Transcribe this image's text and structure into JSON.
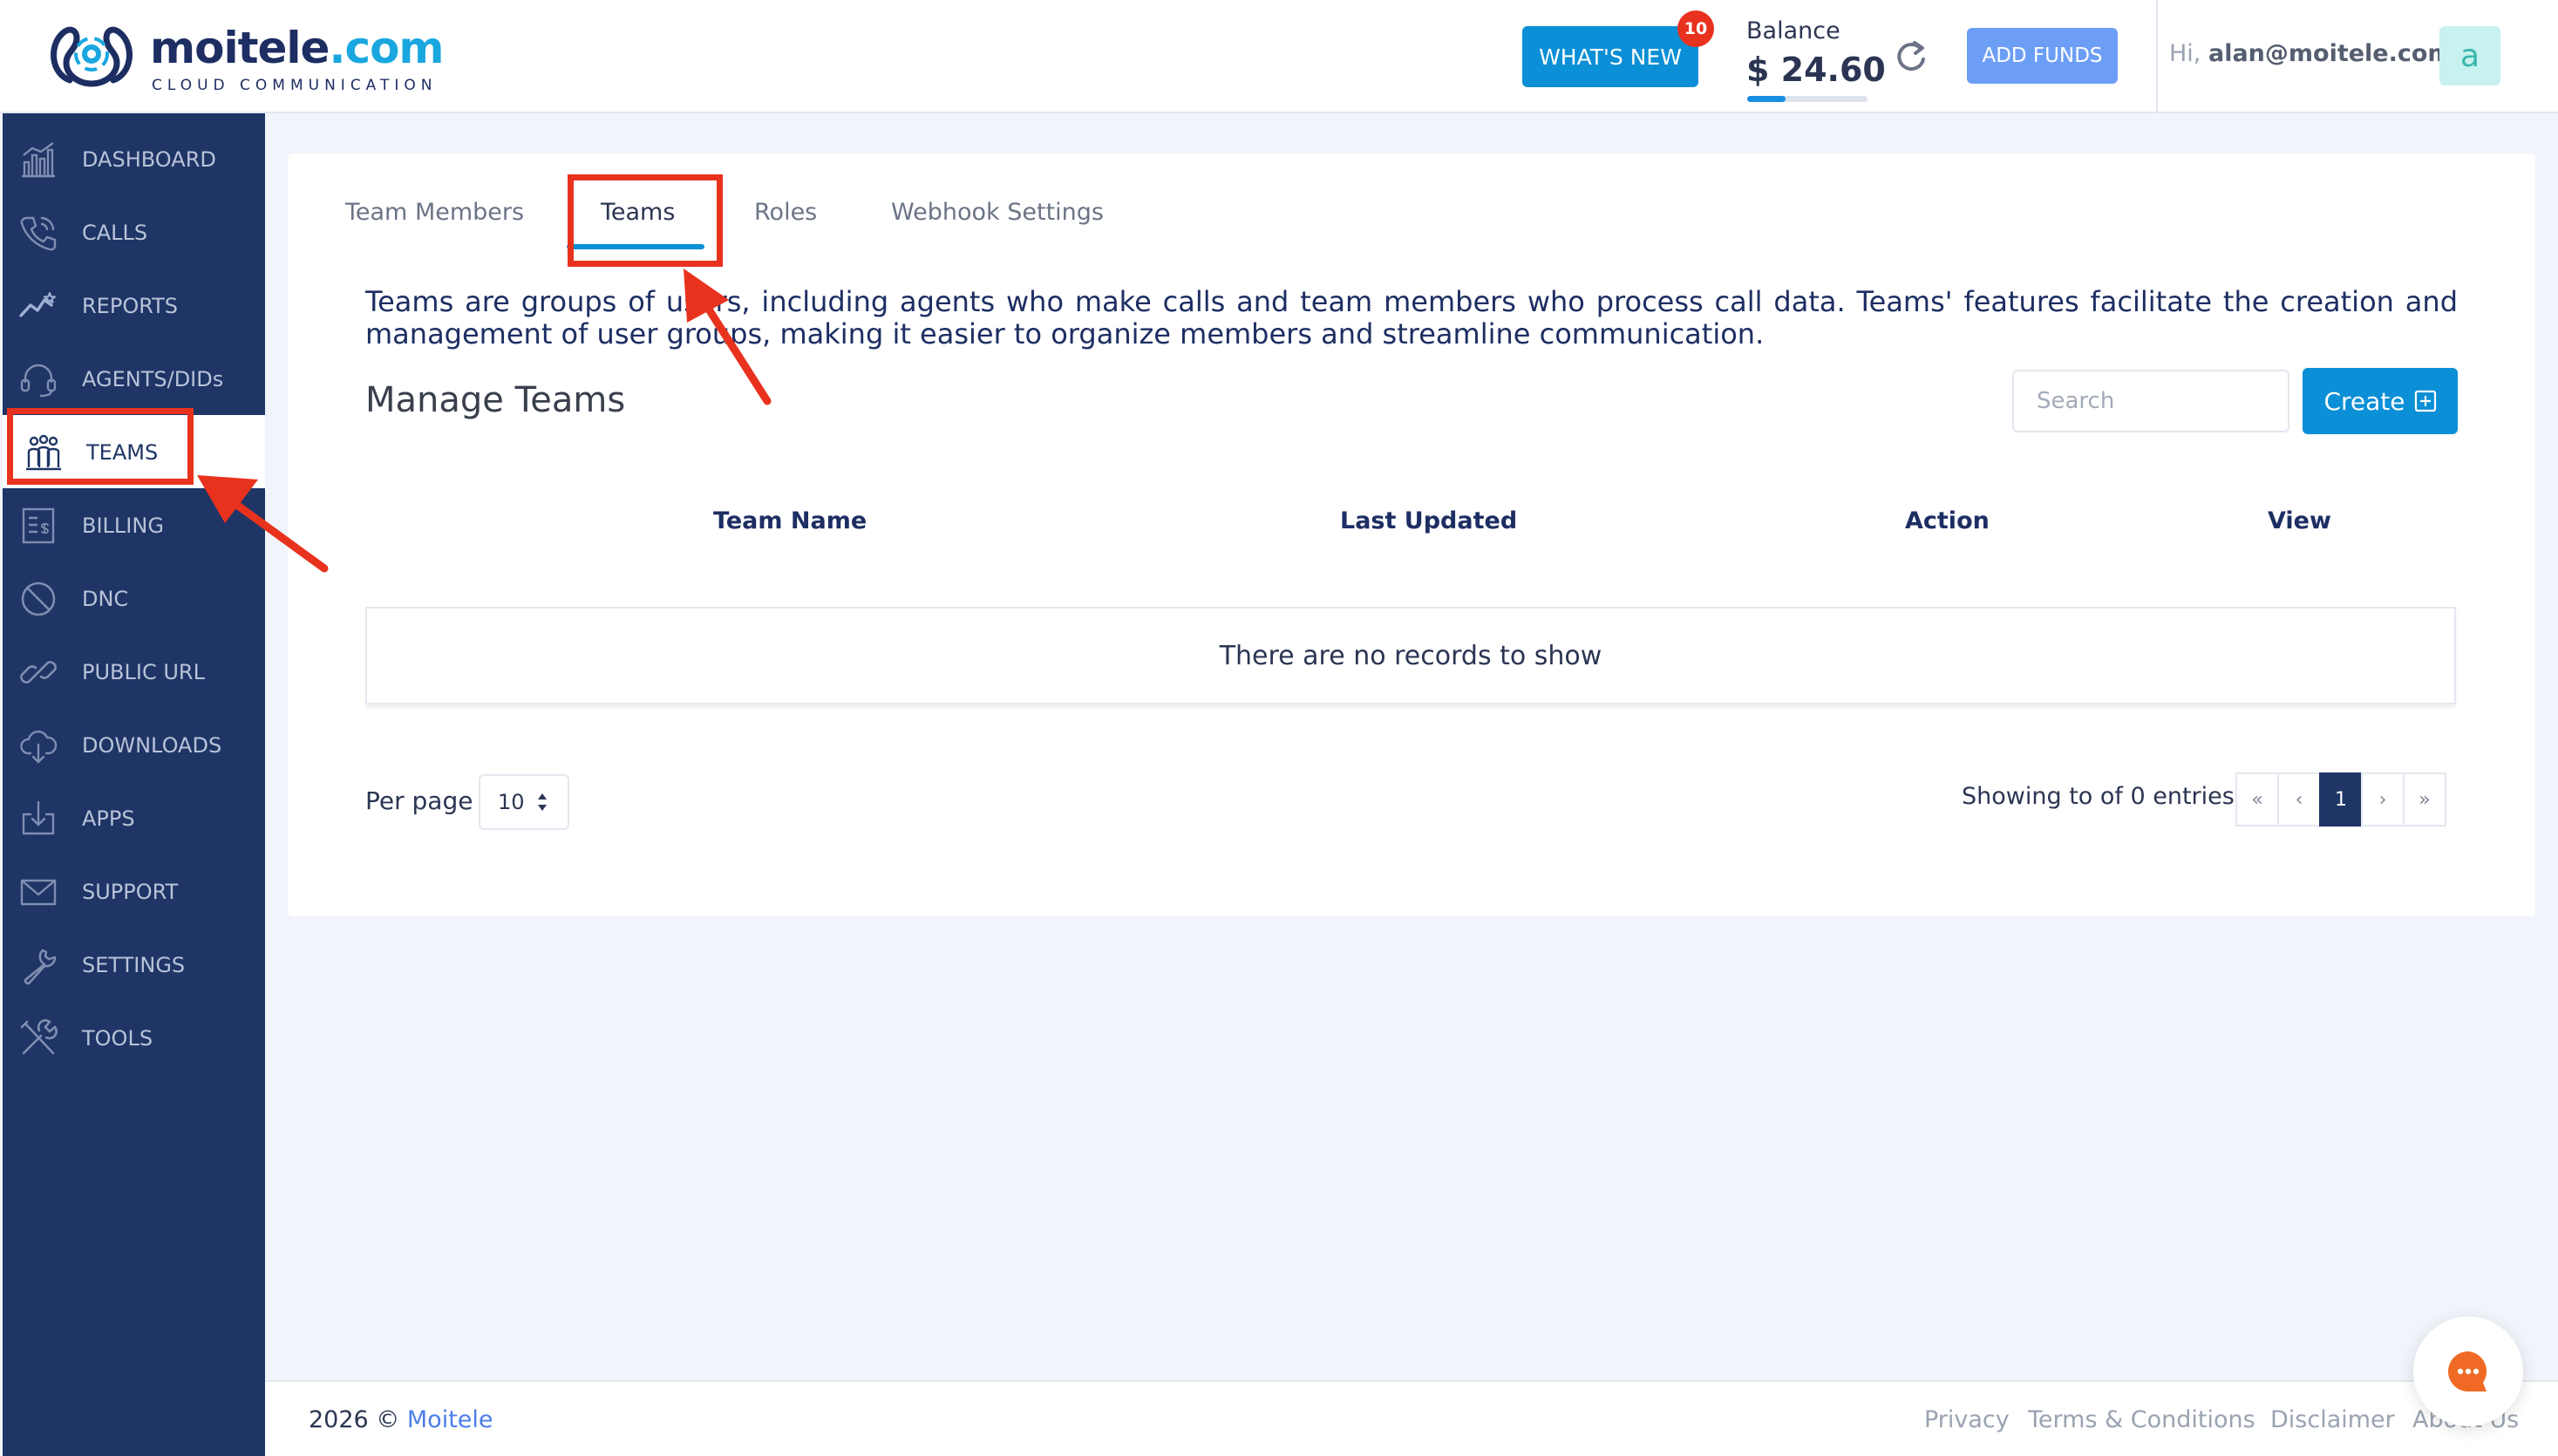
{
  "header": {
    "logo_name": "moitele",
    "logo_domain": ".com",
    "logo_tagline": "CLOUD COMMUNICATION",
    "whats_new_label": "WHAT'S NEW",
    "whats_new_badge": "10",
    "balance_label": "Balance",
    "balance_value": "$ 24.60",
    "balance_progress_fraction": 0.32,
    "add_funds_label": "ADD FUNDS",
    "greeting_prefix": "Hi,",
    "user_email": "alan@moitele.com",
    "avatar_letter": "a"
  },
  "sidebar": {
    "items": [
      {
        "label": "DASHBOARD",
        "icon": "dashboard-chart-icon"
      },
      {
        "label": "CALLS",
        "icon": "phone-icon"
      },
      {
        "label": "REPORTS",
        "icon": "trend-line-icon"
      },
      {
        "label": "AGENTS/DIDs",
        "icon": "headset-icon"
      },
      {
        "label": "TEAMS",
        "icon": "people-group-icon",
        "active": true
      },
      {
        "label": "BILLING",
        "icon": "invoice-icon"
      },
      {
        "label": "DNC",
        "icon": "block-icon"
      },
      {
        "label": "PUBLIC URL",
        "icon": "link-icon"
      },
      {
        "label": "DOWNLOADS",
        "icon": "cloud-download-icon"
      },
      {
        "label": "APPS",
        "icon": "app-download-icon"
      },
      {
        "label": "SUPPORT",
        "icon": "envelope-icon"
      },
      {
        "label": "SETTINGS",
        "icon": "wrench-icon"
      },
      {
        "label": "TOOLS",
        "icon": "tools-icon"
      }
    ]
  },
  "main": {
    "tabs": [
      {
        "label": "Team Members"
      },
      {
        "label": "Teams",
        "active": true
      },
      {
        "label": "Roles"
      },
      {
        "label": "Webhook Settings"
      }
    ],
    "description": "Teams are groups of users, including agents who make calls and team members who process call data. Teams' features facilitate the creation and management of user groups, making it easier to organize members and streamline communication.",
    "title": "Manage Teams",
    "search_placeholder": "Search",
    "create_label": "Create",
    "table": {
      "columns": [
        "Team Name",
        "Last Updated",
        "Action",
        "View"
      ],
      "empty_message": "There are no records to show"
    },
    "per_page_label": "Per page",
    "per_page_value": "10",
    "showing_text": "Showing to of 0 entries",
    "pager": {
      "first": "«",
      "prev": "‹",
      "current": "1",
      "next": "›",
      "last": "»"
    }
  },
  "footer": {
    "year": "2026 ©",
    "brand": "Moitele",
    "links": [
      "Privacy",
      "Terms & Conditions",
      "Disclaimer",
      "About Us"
    ]
  },
  "colors": {
    "sidebar": "#1e3566",
    "primary": "#0b8fd6",
    "annotation_red": "#e8321e",
    "add_funds": "#6d9ef6"
  }
}
